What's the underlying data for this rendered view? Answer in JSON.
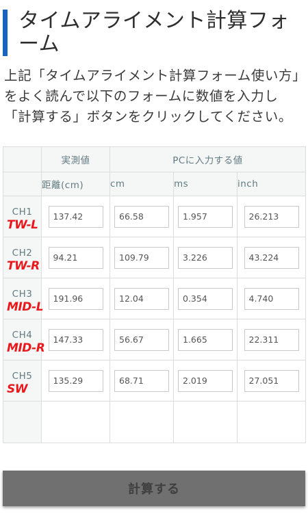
{
  "page": {
    "title": "タイムアライメント計算フォーム",
    "intro": "上記「タイムアライメント計算フォーム使い方」をよく読んで以下のフォームに数値を入力し「計算する」ボタンをクリックしてください。"
  },
  "table": {
    "group_headers": {
      "measured": "実測値",
      "pc_input": "PCに入力する値"
    },
    "column_headers": {
      "distance": "距離(cm)",
      "cm": "cm",
      "ms": "ms",
      "inch": "inch"
    },
    "rows": [
      {
        "channel": "CH1",
        "note": "TW-L",
        "distance": "137.42",
        "cm": "66.58",
        "ms": "1.957",
        "inch": "26.213"
      },
      {
        "channel": "CH2",
        "note": "TW-R",
        "distance": "94.21",
        "cm": "109.79",
        "ms": "3.226",
        "inch": "43.224"
      },
      {
        "channel": "CH3",
        "note": "MID-L",
        "distance": "191.96",
        "cm": "12.04",
        "ms": "0.354",
        "inch": "4.740"
      },
      {
        "channel": "CH4",
        "note": "MID-R",
        "distance": "147.33",
        "cm": "56.67",
        "ms": "1.665",
        "inch": "22.311"
      },
      {
        "channel": "CH5",
        "note": "SW",
        "distance": "135.29",
        "cm": "68.71",
        "ms": "2.019",
        "inch": "27.051"
      }
    ]
  },
  "actions": {
    "calculate_label": "計算する"
  },
  "colors": {
    "accent": "#1565c0",
    "note": "#e8181c",
    "header_text": "#617a80",
    "button": "#707070"
  }
}
